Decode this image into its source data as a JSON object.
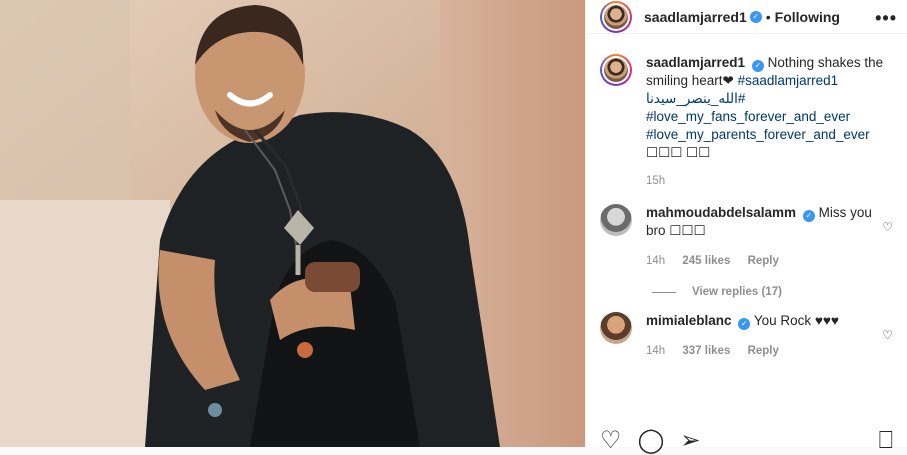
{
  "header": {
    "username": "saadlamjarred1",
    "follow_label": "Following",
    "dot": "•",
    "more": "•••"
  },
  "caption": {
    "username": "saadlamjarred1",
    "text": "Nothing shakes the smiling heart❤",
    "hashtags": [
      "#saadlamjarred1",
      "#الله_ينصر_سيدنا",
      "#love_my_fans_forever_and_ever",
      "#love_my_parents_forever_and_ever"
    ],
    "emojis": "☐☐☐ ☐☐",
    "time": "15h"
  },
  "comments": [
    {
      "username": "mahmoudabdelsalamm",
      "text": "Miss you bro ☐☐☐",
      "time": "14h",
      "likes": "245 likes",
      "reply": "Reply",
      "view_replies": "View replies (17)"
    },
    {
      "username": "mimialeblanc",
      "text": "You Rock ♥♥♥",
      "time": "14h",
      "likes": "337 likes",
      "reply": "Reply"
    }
  ],
  "actions": {
    "like_icon": "heart-outline-icon",
    "comment_icon": "comment-icon",
    "share_icon": "paper-plane-icon",
    "save_icon": "bookmark-icon"
  },
  "colors": {
    "link": "#00376b",
    "muted": "#8e8e8e",
    "verified": "#3897f0"
  }
}
